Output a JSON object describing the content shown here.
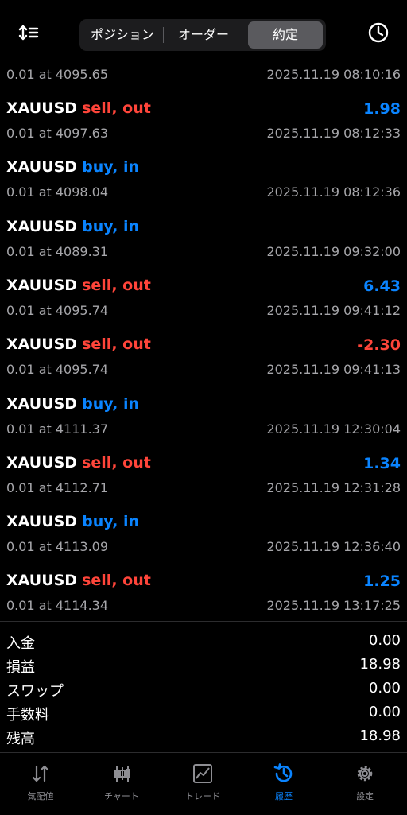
{
  "header": {
    "tabs": [
      {
        "label": "ポジション"
      },
      {
        "label": "オーダー"
      },
      {
        "label": "約定"
      }
    ],
    "selected_tab": "約定",
    "left_icon": "sort-icon",
    "right_icon": "clock-icon"
  },
  "colors": {
    "sell": "#ff453a",
    "buy": "#0a84ff",
    "accent": "#0a84ff",
    "muted": "#a6a6aa"
  },
  "partial_row": {
    "price": "0.01 at 4095.65",
    "time": "2025.11.19 08:10:16"
  },
  "deals": [
    {
      "symbol": "XAUUSD",
      "action": "sell, out",
      "side": "sell",
      "profit": "1.98",
      "price": "0.01 at 4097.63",
      "time": "2025.11.19 08:12:33"
    },
    {
      "symbol": "XAUUSD",
      "action": "buy, in",
      "side": "buy",
      "profit": "",
      "price": "0.01 at 4098.04",
      "time": "2025.11.19 08:12:36"
    },
    {
      "symbol": "XAUUSD",
      "action": "buy, in",
      "side": "buy",
      "profit": "",
      "price": "0.01 at 4089.31",
      "time": "2025.11.19 09:32:00"
    },
    {
      "symbol": "XAUUSD",
      "action": "sell, out",
      "side": "sell",
      "profit": "6.43",
      "price": "0.01 at 4095.74",
      "time": "2025.11.19 09:41:12"
    },
    {
      "symbol": "XAUUSD",
      "action": "sell, out",
      "side": "sell",
      "profit": "-2.30",
      "price": "0.01 at 4095.74",
      "time": "2025.11.19 09:41:13"
    },
    {
      "symbol": "XAUUSD",
      "action": "buy, in",
      "side": "buy",
      "profit": "",
      "price": "0.01 at 4111.37",
      "time": "2025.11.19 12:30:04"
    },
    {
      "symbol": "XAUUSD",
      "action": "sell, out",
      "side": "sell",
      "profit": "1.34",
      "price": "0.01 at 4112.71",
      "time": "2025.11.19 12:31:28"
    },
    {
      "symbol": "XAUUSD",
      "action": "buy, in",
      "side": "buy",
      "profit": "",
      "price": "0.01 at 4113.09",
      "time": "2025.11.19 12:36:40"
    },
    {
      "symbol": "XAUUSD",
      "action": "sell, out",
      "side": "sell",
      "profit": "1.25",
      "price": "0.01 at 4114.34",
      "time": "2025.11.19 13:17:25"
    }
  ],
  "summary": [
    {
      "label": "入金",
      "value": "0.00"
    },
    {
      "label": "損益",
      "value": "18.98"
    },
    {
      "label": "スワップ",
      "value": "0.00"
    },
    {
      "label": "手数料",
      "value": "0.00"
    },
    {
      "label": "残高",
      "value": "18.98"
    }
  ],
  "tabbar": [
    {
      "label": "気配値",
      "icon": "quotes-icon"
    },
    {
      "label": "チャート",
      "icon": "chart-icon"
    },
    {
      "label": "トレード",
      "icon": "trade-icon"
    },
    {
      "label": "履歴",
      "icon": "history-icon",
      "active": true
    },
    {
      "label": "設定",
      "icon": "settings-icon"
    }
  ]
}
